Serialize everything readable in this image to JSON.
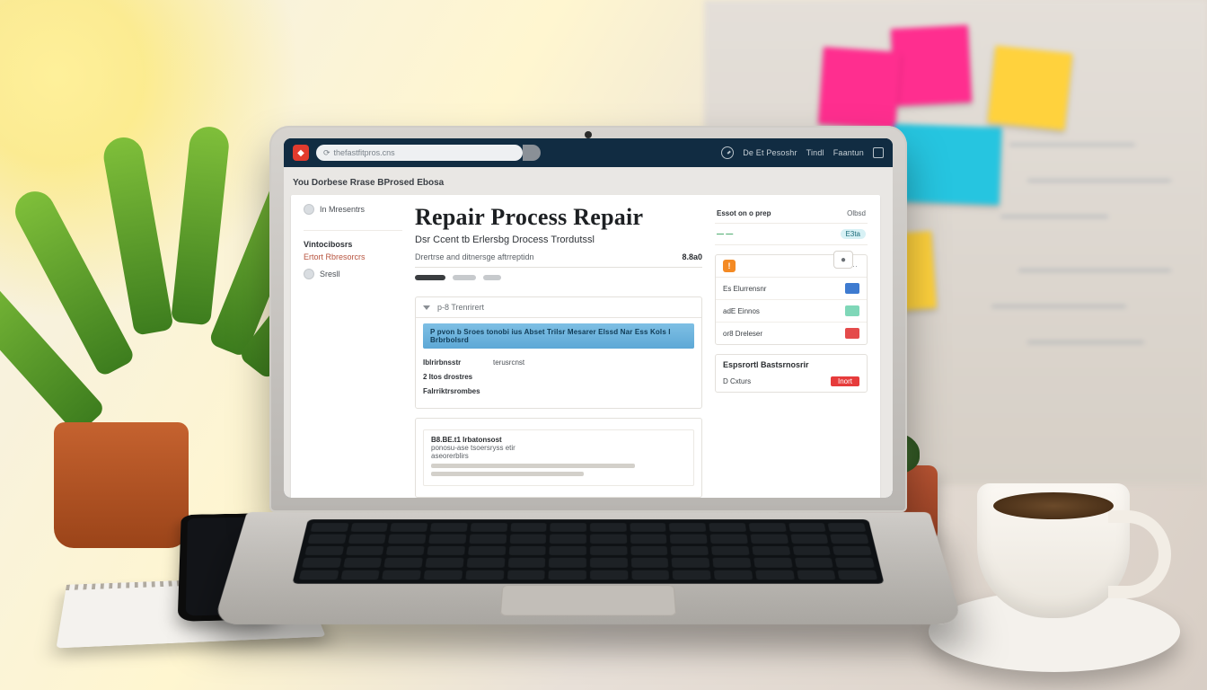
{
  "browser": {
    "url_display": "thefastfitpros.cns",
    "nav_items": [
      "De Et Pesoshr",
      "Tindl",
      "Faantun"
    ]
  },
  "breadcrumb": "You Dorbese Rrase BProsed Ebosa",
  "corner_btn": "●",
  "page": {
    "title": "Repair Process Repair",
    "subtitle": "Dsr Ccent tb Erlersbg Drocess Trordutssl"
  },
  "left": {
    "item1": "In Mresentrs",
    "heading1": "Vintocibosrs",
    "link1": "Ertort Rbresorcrs",
    "bullet1": "Sresll"
  },
  "toolbar": {
    "label": "Drertrse and ditnersge aftrreptidn",
    "amount": "8.8a0"
  },
  "meta": {
    "row1_label": "Essot on o prep",
    "row1_value": "Olbsd",
    "row2_value": "E3ta",
    "panel_head": "p-8 Trenrirert"
  },
  "banner": "P pvon b Sroes tonobi ius Abset Trilsr Mesarer Elssd Nar Ess Kols l Brbrbolsrd",
  "form": {
    "f1_label": "Iblrirbnsstr",
    "f1_value": "terusrcnst",
    "f2_label": "2 Itos drostres",
    "f3_label": "Falrriktrsrombes"
  },
  "textcard": {
    "l1": "B8.BE.t1 Irbatonsost",
    "l2": "ponosu-ase tsoersryss etir",
    "l3": "aseorerblirs"
  },
  "statuscard": {
    "row1": "Es Elurrensnr",
    "row2": "adE Einnos",
    "row3": "or8 Dreleser"
  },
  "card2": {
    "title": "Espsrortl Bastsrnosrir",
    "line": "D Cxturs",
    "badge": "Inort"
  }
}
